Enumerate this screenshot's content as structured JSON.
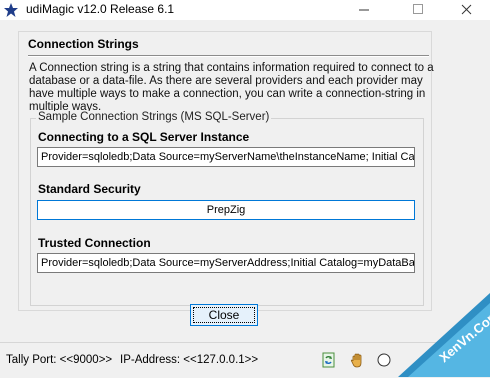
{
  "window": {
    "title": "udiMagic v12.0 Release 6.1"
  },
  "dialog": {
    "heading": "Connection Strings",
    "description": "A Connection string is a string that contains information required to connect to a database or a data-file. As there are several providers and each provider may have multiple ways to make a connection, you can write a connection-string in multiple ways.",
    "group_title": "Sample Connection Strings (MS SQL-Server)",
    "sections": {
      "sql_instance": {
        "label": "Connecting to a SQL Server Instance",
        "value": "Provider=sqloledb;Data Source=myServerName\\theInstanceName; Initial Catal"
      },
      "standard": {
        "label": "Standard Security",
        "value": "PrepZig"
      },
      "trusted": {
        "label": "Trusted Connection",
        "value": "Provider=sqloledb;Data Source=myServerAddress;Initial Catalog=myDataBase;I"
      }
    },
    "close_label": "Close"
  },
  "status": {
    "tally_port": "Tally Port: <<9000>>",
    "ip_address": "IP-Address: <<127.0.0.1>>",
    "icons": [
      "refresh-icon",
      "hand-icon",
      "radio-icon"
    ]
  },
  "watermark": {
    "text": "XenVn.Com"
  }
}
